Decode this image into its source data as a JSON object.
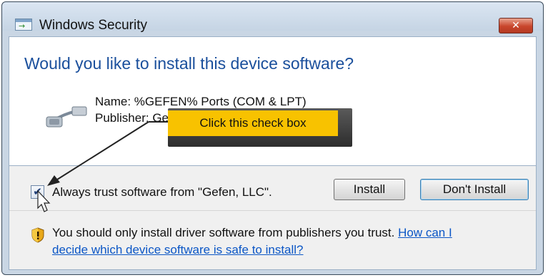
{
  "window": {
    "title": "Windows Security",
    "close_glyph": "✕"
  },
  "content": {
    "headline": "Would you like to install this device software?",
    "name_line": "Name: %GEFEN% Ports (COM & LPT)",
    "publisher_line": "Publisher: Ge"
  },
  "footer": {
    "checkbox_checked": true,
    "check_glyph": "✔",
    "checkbox_label": "Always trust software from \"Gefen, LLC\".",
    "install_label": "Install",
    "dont_install_label": "Don't Install",
    "warning_text": "You should only install driver software from publishers you trust.",
    "link_part1": "How can I",
    "link_part2": "decide which device software is safe to install?"
  },
  "callout": {
    "text": "Click this check box",
    "color": "#f8c200"
  },
  "icons": {
    "app": "windows-security-icon",
    "device": "serial-cable-icon",
    "warning": "shield-warning-icon",
    "close": "close-icon",
    "cursor": "mouse-cursor-icon"
  }
}
